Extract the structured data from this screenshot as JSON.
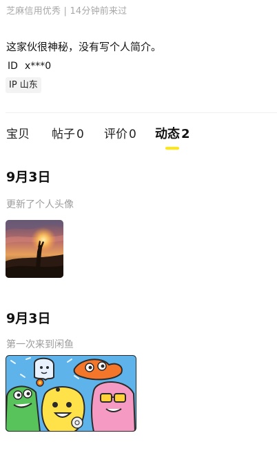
{
  "profile": {
    "status_line": "芝麻信用优秀 | 14分钟前来过",
    "bio": "这家伙很神秘，没有写个人简介。",
    "id_label": "ID",
    "id_value": "x***0",
    "ip_label": "IP 山东"
  },
  "tabs": [
    {
      "label": "宝贝",
      "count": ""
    },
    {
      "label": "帖子",
      "count": "0"
    },
    {
      "label": "评价",
      "count": "0"
    },
    {
      "label": "动态",
      "count": "2"
    }
  ],
  "active_tab": "动态",
  "feed": [
    {
      "date": "9月3日",
      "text": "更新了个人头像",
      "image": "sunset-hand-photo"
    },
    {
      "date": "9月3日",
      "text": "第一次来到闲鱼",
      "image": "xianyu-cartoon-characters"
    }
  ],
  "colors": {
    "accent_yellow": "#ffe60f",
    "muted_text": "#9c9c9c"
  }
}
